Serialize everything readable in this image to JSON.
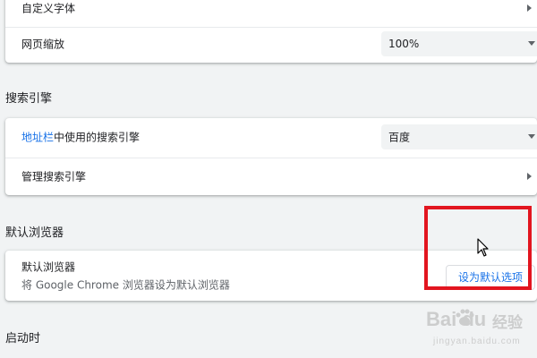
{
  "appearance": {
    "custom_fonts_label": "自定义字体",
    "page_zoom_label": "网页缩放",
    "page_zoom_value": "100%"
  },
  "search_engine": {
    "section_title": "搜索引擎",
    "address_bar_prefix": "地址栏",
    "address_bar_suffix": "中使用的搜索引擎",
    "engine_value": "百度",
    "manage_label": "管理搜索引擎"
  },
  "default_browser": {
    "section_title": "默认浏览器",
    "title": "默认浏览器",
    "description": "将 Google Chrome 浏览器设为默认浏览器",
    "button_label": "设为默认选项"
  },
  "startup": {
    "section_title": "启动时"
  },
  "watermark": {
    "brand": "Bai du",
    "product": "经验",
    "url": "jingyan.baidu.com"
  },
  "colors": {
    "link": "#1a73e8",
    "highlight": "#e2151f",
    "background": "#f1f3f4"
  }
}
